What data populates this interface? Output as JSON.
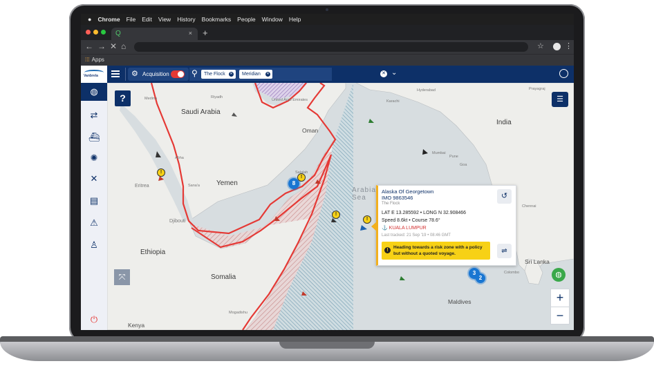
{
  "mac_menu": {
    "apple": "",
    "items": [
      "Chrome",
      "File",
      "Edit",
      "View",
      "History",
      "Bookmarks",
      "People",
      "Window",
      "Help"
    ]
  },
  "browser": {
    "tab_favicon": "Q",
    "tab_close": "×",
    "new_tab": "+",
    "bookmark": "Apps",
    "nav": {
      "back": "←",
      "forward": "→",
      "stop": "✕",
      "home": "⌂"
    }
  },
  "header": {
    "acquisition_label": "Acquisition",
    "acquisition_on": true,
    "filters": [
      "The Flock",
      "Meridian"
    ],
    "logo_text": "Vanbrela"
  },
  "map": {
    "labels": {
      "saudi_arabia": "Saudi Arabia",
      "oman": "Oman",
      "yemen": "Yemen",
      "ethiopia": "Ethiopia",
      "somalia": "Somalia",
      "kenya": "Kenya",
      "eritrea": "Eritrea",
      "djibouti": "Djibouti",
      "india": "India",
      "sri_lanka": "Sri Lanka",
      "maldives": "Maldives",
      "arabian_sea": "Arabian Sea",
      "uae": "United Arab Emirates",
      "medina": "Medina",
      "riyadh": "Riyadh",
      "abha": "Abha",
      "sanaa": "Sana'a",
      "salalah": "Salalah",
      "mumbai": "Mumbai",
      "pune": "Pune",
      "goa": "Goa",
      "chennai": "Chennai",
      "karachi": "Karachi",
      "hyderabad": "Hyderabad",
      "colombo": "Colombo",
      "mogadishu": "Mogadishu",
      "prayagraj": "Prayagraj"
    },
    "clusters": {
      "c8": "8",
      "c3": "3",
      "c2": "2"
    },
    "warn_symbol": "!"
  },
  "popup": {
    "vessel_name": "Alaska Of Georgetown",
    "imo": "IMO 9863546",
    "fleet": "The Flock",
    "position": "LAT E 13.285592 • LONG N 32.908466",
    "speed_course": "Speed 8.6kt • Course 78.6°",
    "destination": "⚓ KUALA LUMPUR",
    "last_tracked": "Last tracked: 21 Sep '19 • 08:46 GMT",
    "alert": "Heading towards a risk zone with a policy but without a quoted voyage."
  },
  "controls": {
    "help": "?",
    "zoom_in": "+",
    "zoom_out": "−"
  },
  "colors": {
    "navy": "#0d3068",
    "risk_red": "#e53935",
    "warn_yellow": "#f7d116",
    "cluster_blue": "#1976d2",
    "green": "#3aa84a"
  }
}
